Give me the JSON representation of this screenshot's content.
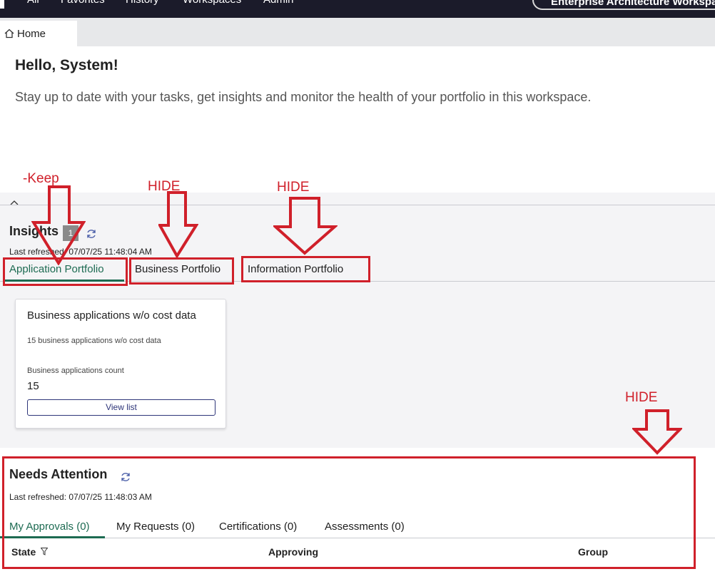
{
  "topnav": {
    "items": [
      "All",
      "Favorites",
      "History",
      "Workspaces",
      "Admin"
    ],
    "workspace": "Enterprise Architecture Workspace"
  },
  "tabstrip": {
    "home_label": "Home"
  },
  "greeting": {
    "title": "Hello, System!",
    "subtitle": "Stay up to date with your tasks, get insights and monitor the health of your portfolio in this workspace."
  },
  "insights": {
    "title": "Insights",
    "badge": "1",
    "last_refreshed": "Last refreshed: 07/07/25 11:48:04 AM",
    "tabs": [
      "Application Portfolio",
      "Business Portfolio",
      "Information Portfolio"
    ],
    "active_tab_index": 0,
    "card": {
      "title": "Business applications w/o cost data",
      "description": "15 business applications w/o cost data",
      "count_label": "Business applications count",
      "count": "15",
      "button": "View list"
    }
  },
  "needs_attention": {
    "title": "Needs Attention",
    "last_refreshed": "Last refreshed: 07/07/25 11:48:03 AM",
    "tabs": [
      "My Approvals (0)",
      "My Requests (0)",
      "Certifications (0)",
      "Assessments (0)"
    ],
    "active_tab_index": 0,
    "columns": [
      "State",
      "Approving",
      "Group"
    ]
  },
  "annotations": {
    "keep": "-Keep",
    "hide1": "HIDE",
    "hide2": "HIDE",
    "hide3": "HIDE"
  },
  "colors": {
    "nav_bg": "#1b1b2a",
    "accent_green": "#1d6b52",
    "annotation_red": "#d0202a",
    "button_blue": "#2e3579"
  }
}
